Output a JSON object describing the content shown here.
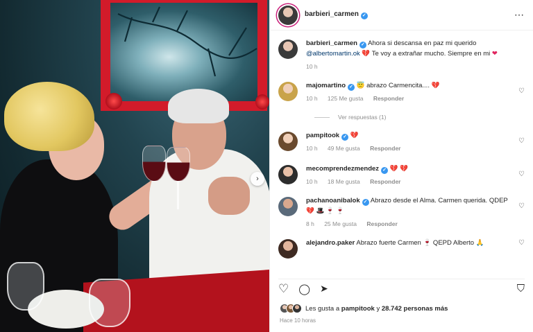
{
  "header": {
    "username": "barbieri_carmen",
    "more_icon": "⋯"
  },
  "caption": {
    "username": "barbieri_carmen",
    "text_1": "Ahora si descansa en paz mi querido",
    "mention": "@albertomartin.ok",
    "text_2": "Te voy a extrañar mucho. Siempre en mi",
    "heart_1": "💔",
    "heart_2": "❤",
    "time": "10 h"
  },
  "comments": [
    {
      "username": "majomartino",
      "verified": true,
      "text": "abrazo Carmencita.... 💔",
      "emoji": "😇",
      "time": "10 h",
      "likes": "125 Me gusta",
      "reply": "Responder",
      "view_replies": "Ver respuestas (1)"
    },
    {
      "username": "pampitook",
      "verified": true,
      "text": "💔",
      "time": "10 h",
      "likes": "49 Me gusta",
      "reply": "Responder"
    },
    {
      "username": "mecomprendezmendez",
      "verified": true,
      "text": "💔 💔",
      "time": "10 h",
      "likes": "18 Me gusta",
      "reply": "Responder"
    },
    {
      "username": "pachanoanibalok",
      "verified": true,
      "text": "Abrazo desde el Alma. Carmen querida. QDEP 💔 🎩 🍷 🍷",
      "time": "8 h",
      "likes": "25 Me gusta",
      "reply": "Responder"
    },
    {
      "username": "alejandro.paker",
      "verified": false,
      "text": "Abrazo fuerte Carmen 🍷 QEPD Alberto 🙏"
    }
  ],
  "actions": {
    "like_icon": "♡",
    "comment_icon": "◯",
    "share_icon": "➤",
    "save_icon": "⛉"
  },
  "likes": {
    "prefix": "Les gusta a",
    "user": "pampitook",
    "middle": "y",
    "count": "28.742 personas más"
  },
  "posted_ago": "Hace 10 horas",
  "carousel_arrow": "›",
  "colors": {
    "heart_red": "#e0245e",
    "verified_blue": "#3897f0",
    "mention_blue": "#00376b"
  }
}
